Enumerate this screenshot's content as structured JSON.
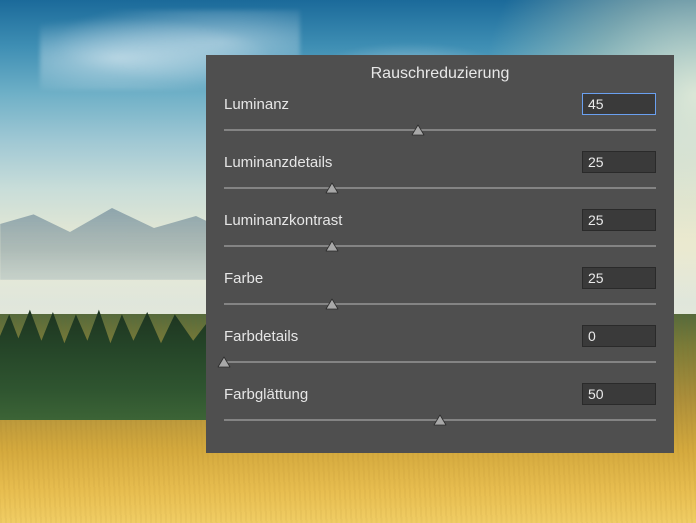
{
  "panel": {
    "title": "Rauschreduzierung",
    "sliders": [
      {
        "label": "Luminanz",
        "value": "45",
        "pos": 45,
        "focused": true
      },
      {
        "label": "Luminanzdetails",
        "value": "25",
        "pos": 25,
        "focused": false
      },
      {
        "label": "Luminanzkontrast",
        "value": "25",
        "pos": 25,
        "focused": false
      },
      {
        "label": "Farbe",
        "value": "25",
        "pos": 25,
        "focused": false
      },
      {
        "label": "Farbdetails",
        "value": "0",
        "pos": 0,
        "focused": false
      },
      {
        "label": "Farbglättung",
        "value": "50",
        "pos": 50,
        "focused": false
      }
    ]
  }
}
